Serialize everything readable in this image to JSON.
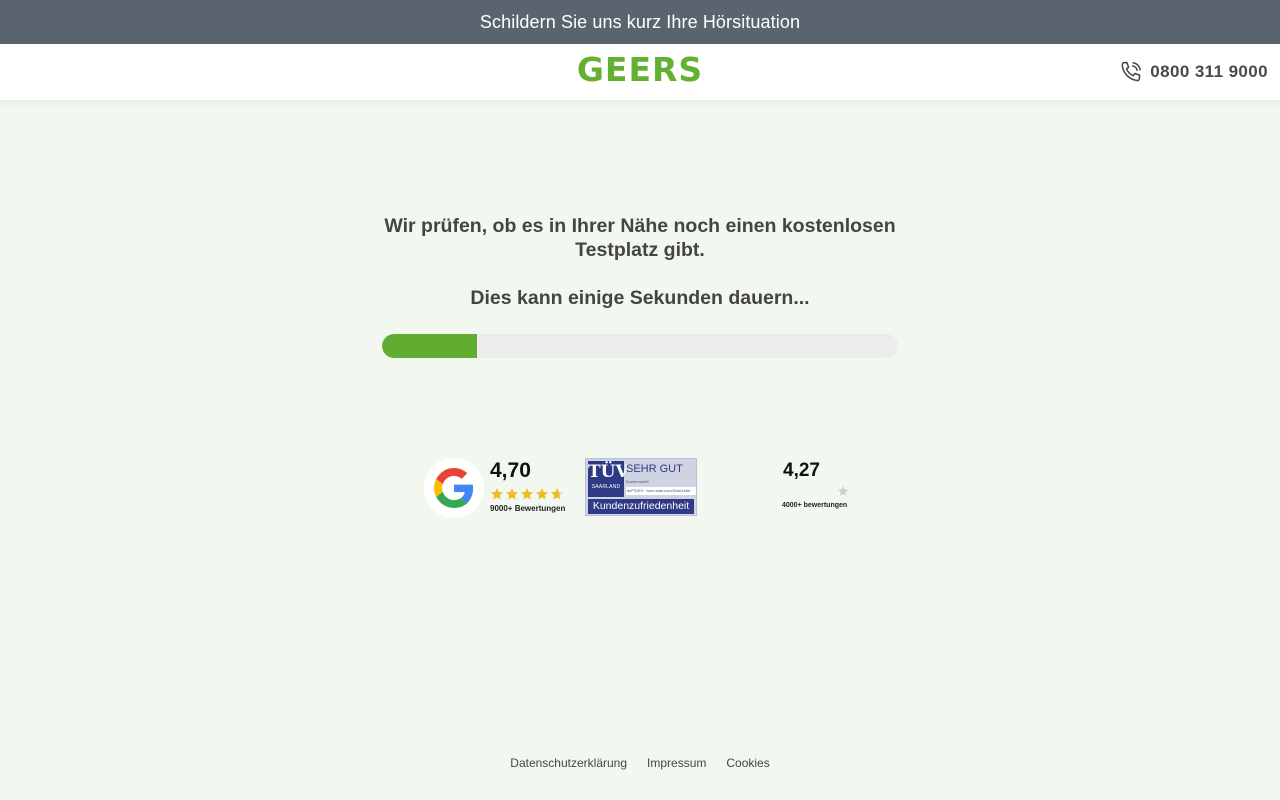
{
  "topbar": {
    "text": "Schildern Sie uns kurz Ihre Hörsituation"
  },
  "header": {
    "logo": "GEERS",
    "phone": "0800 311 9000",
    "phone_icon": "phone-icon"
  },
  "main": {
    "headline": "Wir prüfen, ob es in Ihrer Nähe noch einen kostenlosen Testplatz gibt.",
    "subline": "Dies kann einige Sekunden dauern...",
    "progress_percent": 18.5
  },
  "ratings": {
    "google": {
      "icon": "google-logo-icon",
      "value": "4,70",
      "count": "9000+ Bewertungen",
      "stars_filled": 4.7
    },
    "tuv": {
      "logo_line1": "TÜV",
      "logo_line2": "SAARLAND",
      "grade": "SEHR GUT",
      "line1": "Kundenurteil",
      "line2": "tk/PS/ES · tuev-saar.com/ID##1###",
      "bottom": "Kundenzufriedenheit"
    },
    "second": {
      "value": "4,27",
      "count": "4000+ bewertungen",
      "icon": "star-icon"
    }
  },
  "footer": {
    "links": [
      "Datenschutzerklärung",
      "Impressum",
      "Cookies"
    ]
  },
  "colors": {
    "topbar": "#59646e",
    "brand_green": "#64b033",
    "progress_fill": "#61ad32",
    "page_bg": "#f2f8f0",
    "tuv_blue": "#2e3a83",
    "star": "#f5b921"
  }
}
